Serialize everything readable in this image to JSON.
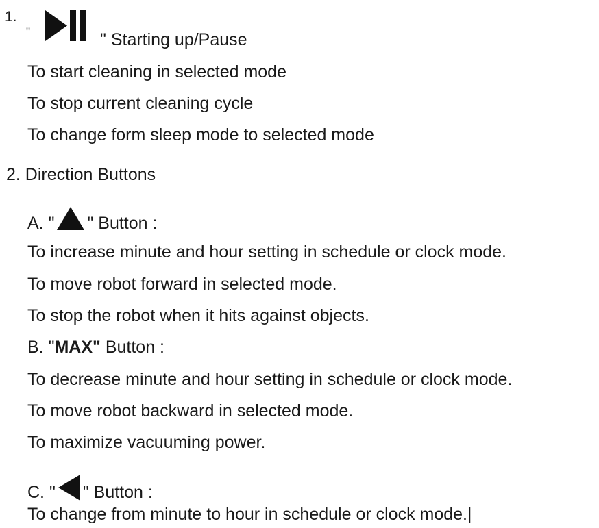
{
  "item1": {
    "number": "1.",
    "quote_open": "\"",
    "quote_close": "\"",
    "title": "Starting up/Pause",
    "icon": "play-pause-icon",
    "lines": [
      "To start cleaning in selected mode",
      "To stop current cleaning cycle",
      "To change form sleep mode to selected mode"
    ]
  },
  "item2": {
    "heading": "2. Direction Buttons",
    "sub_a": {
      "prefix": "A. \"",
      "suffix": "\" Button :",
      "icon": "up-triangle-icon",
      "lines": [
        "To increase minute and hour setting in schedule or clock mode.",
        "To move robot forward in selected mode.",
        "To stop the robot when it hits against objects."
      ]
    },
    "sub_b": {
      "prefix": "B. \"",
      "bold": "MAX\"",
      "suffix": " Button :",
      "lines": [
        "To decrease minute and hour setting in schedule or clock mode.",
        "To move robot backward in selected mode.",
        "To maximize vacuuming power."
      ]
    },
    "sub_c": {
      "prefix": "C. \"",
      "suffix": "\" Button :",
      "icon": "left-triangle-icon",
      "lines": [
        "To change from minute to hour in schedule or clock mode.|"
      ]
    }
  },
  "colors": {
    "text": "#1a1a1a",
    "icon": "#111111",
    "background": "#ffffff"
  }
}
